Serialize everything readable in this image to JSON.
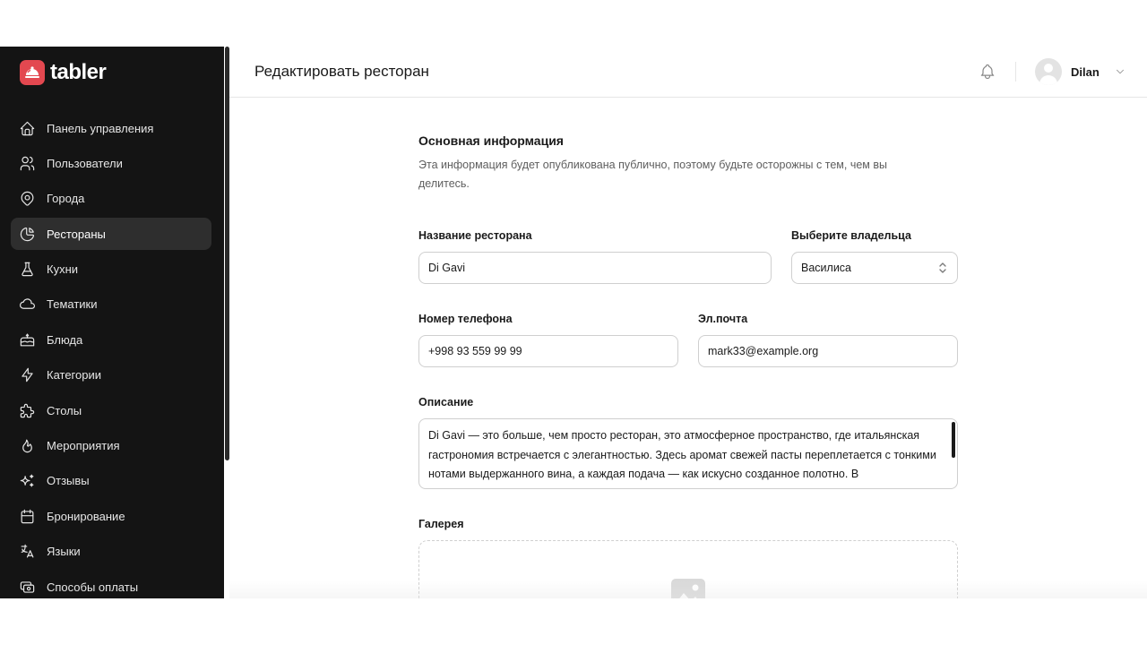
{
  "app": {
    "logo_text": "tabler",
    "brand_color": "#e34850",
    "sidebar_bg": "#141414"
  },
  "sidebar": {
    "items": [
      {
        "label": "Панель управления",
        "icon": "home-icon",
        "active": false
      },
      {
        "label": "Пользователи",
        "icon": "users-icon",
        "active": false
      },
      {
        "label": "Города",
        "icon": "map-pin-icon",
        "active": false
      },
      {
        "label": "Рестораны",
        "icon": "chart-pie-icon",
        "active": true
      },
      {
        "label": "Кухни",
        "icon": "flask-icon",
        "active": false
      },
      {
        "label": "Тематики",
        "icon": "cloud-icon",
        "active": false
      },
      {
        "label": "Блюда",
        "icon": "cake-icon",
        "active": false
      },
      {
        "label": "Категории",
        "icon": "bolt-icon",
        "active": false
      },
      {
        "label": "Столы",
        "icon": "puzzle-icon",
        "active": false
      },
      {
        "label": "Мероприятия",
        "icon": "flame-icon",
        "active": false
      },
      {
        "label": "Отзывы",
        "icon": "sparkles-icon",
        "active": false
      },
      {
        "label": "Бронирование",
        "icon": "calendar-icon",
        "active": false
      },
      {
        "label": "Языки",
        "icon": "language-icon",
        "active": false
      },
      {
        "label": "Способы оплаты",
        "icon": "cash-icon",
        "active": false
      }
    ]
  },
  "header": {
    "title": "Редактировать ресторан",
    "user_name": "Dilan"
  },
  "form": {
    "section_title": "Основная информация",
    "section_desc": "Эта информация будет опубликована публично, поэтому будьте осторожны с тем, чем вы делитесь.",
    "name_label": "Название ресторана",
    "name_value": "Di Gavi",
    "owner_label": "Выберите владельца",
    "owner_value": "Василиса",
    "phone_label": "Номер телефона",
    "phone_value": "+998 93 559 99 99",
    "email_label": "Эл.почта",
    "email_value": "mark33@example.org",
    "description_label": "Описание",
    "description_value": "Di Gavi — это больше, чем просто ресторан, это атмосферное пространство, где итальянская гастрономия встречается с элегантностью. Здесь аромат свежей пасты переплетается с тонкими нотами выдержанного вина, а каждая подача — как искусно созданное полотно. В",
    "gallery_label": "Галерея"
  }
}
